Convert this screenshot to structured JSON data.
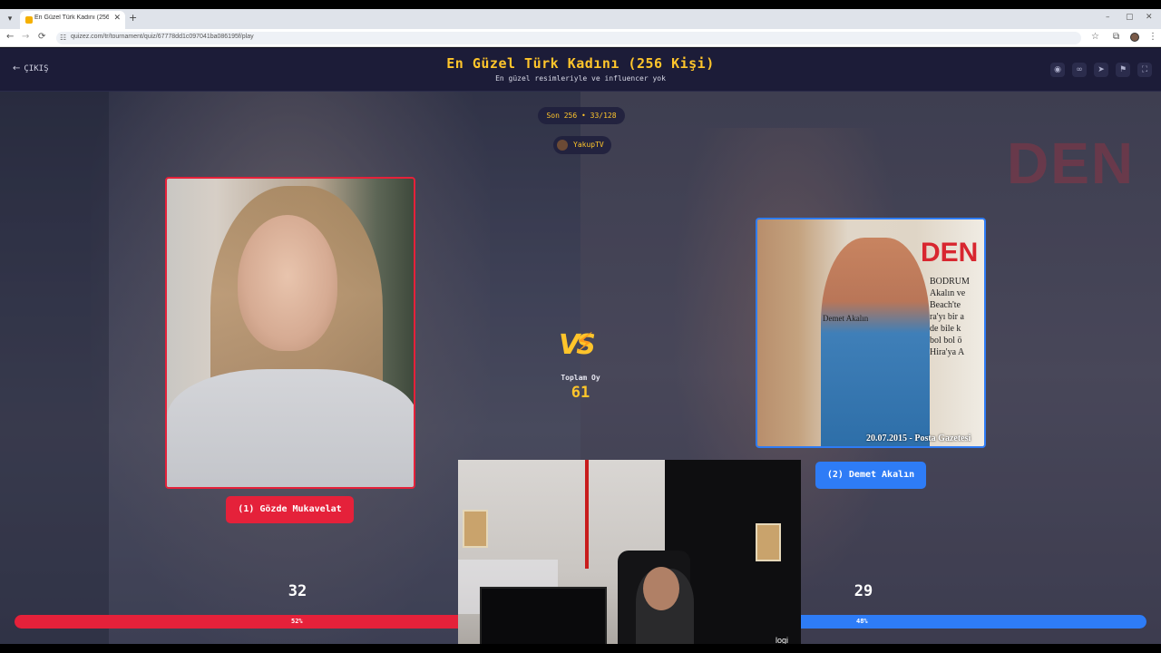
{
  "browser": {
    "tab_title": "En Güzel Türk Kadını (256 Kişi)",
    "new_tab": "+",
    "close_tab": "✕",
    "url": "quizez.com/tr/tournament/quiz/67778dd1c097041ba086195f/play",
    "window_controls": [
      "–",
      "▢",
      "✕"
    ],
    "nav": [
      "←",
      "→",
      "⟳"
    ]
  },
  "header": {
    "exit_label": "ÇIKIŞ",
    "title": "En Güzel Türk Kadını (256 Kişi)",
    "subtitle": "En güzel resimleriyle ve influencer yok",
    "icons": [
      "eye-icon",
      "link-icon",
      "send-icon",
      "flag-icon",
      "fullscreen-icon"
    ]
  },
  "round": {
    "label": "Son 256 • 33/128"
  },
  "streamer": {
    "name": "YakupTV"
  },
  "contestants": {
    "left": {
      "label": "(1) Gözde Mukavelat",
      "votes": "32",
      "percent": "52%",
      "fraction": 0.52,
      "color": "#e5213a"
    },
    "right": {
      "label": "(2) Demet Akalın",
      "votes": "29",
      "percent": "48%",
      "fraction": 0.48,
      "color": "#2e7cf6",
      "photo_caption": "20.07.2015 - Posta Gazetesi",
      "photo_heading": "DEN",
      "photo_label": "Demet Akalın",
      "photo_text": [
        "BODRUM",
        "Akalın ve",
        "Beach'te",
        "ra'yı bir a",
        "de bile k",
        "bol bol ö",
        "Hira'ya A"
      ]
    }
  },
  "vs": {
    "text": "VS",
    "total_label": "Toplam Oy",
    "total": "61"
  },
  "webcam": {
    "brand": "logi"
  },
  "background_right_text": "DEN"
}
